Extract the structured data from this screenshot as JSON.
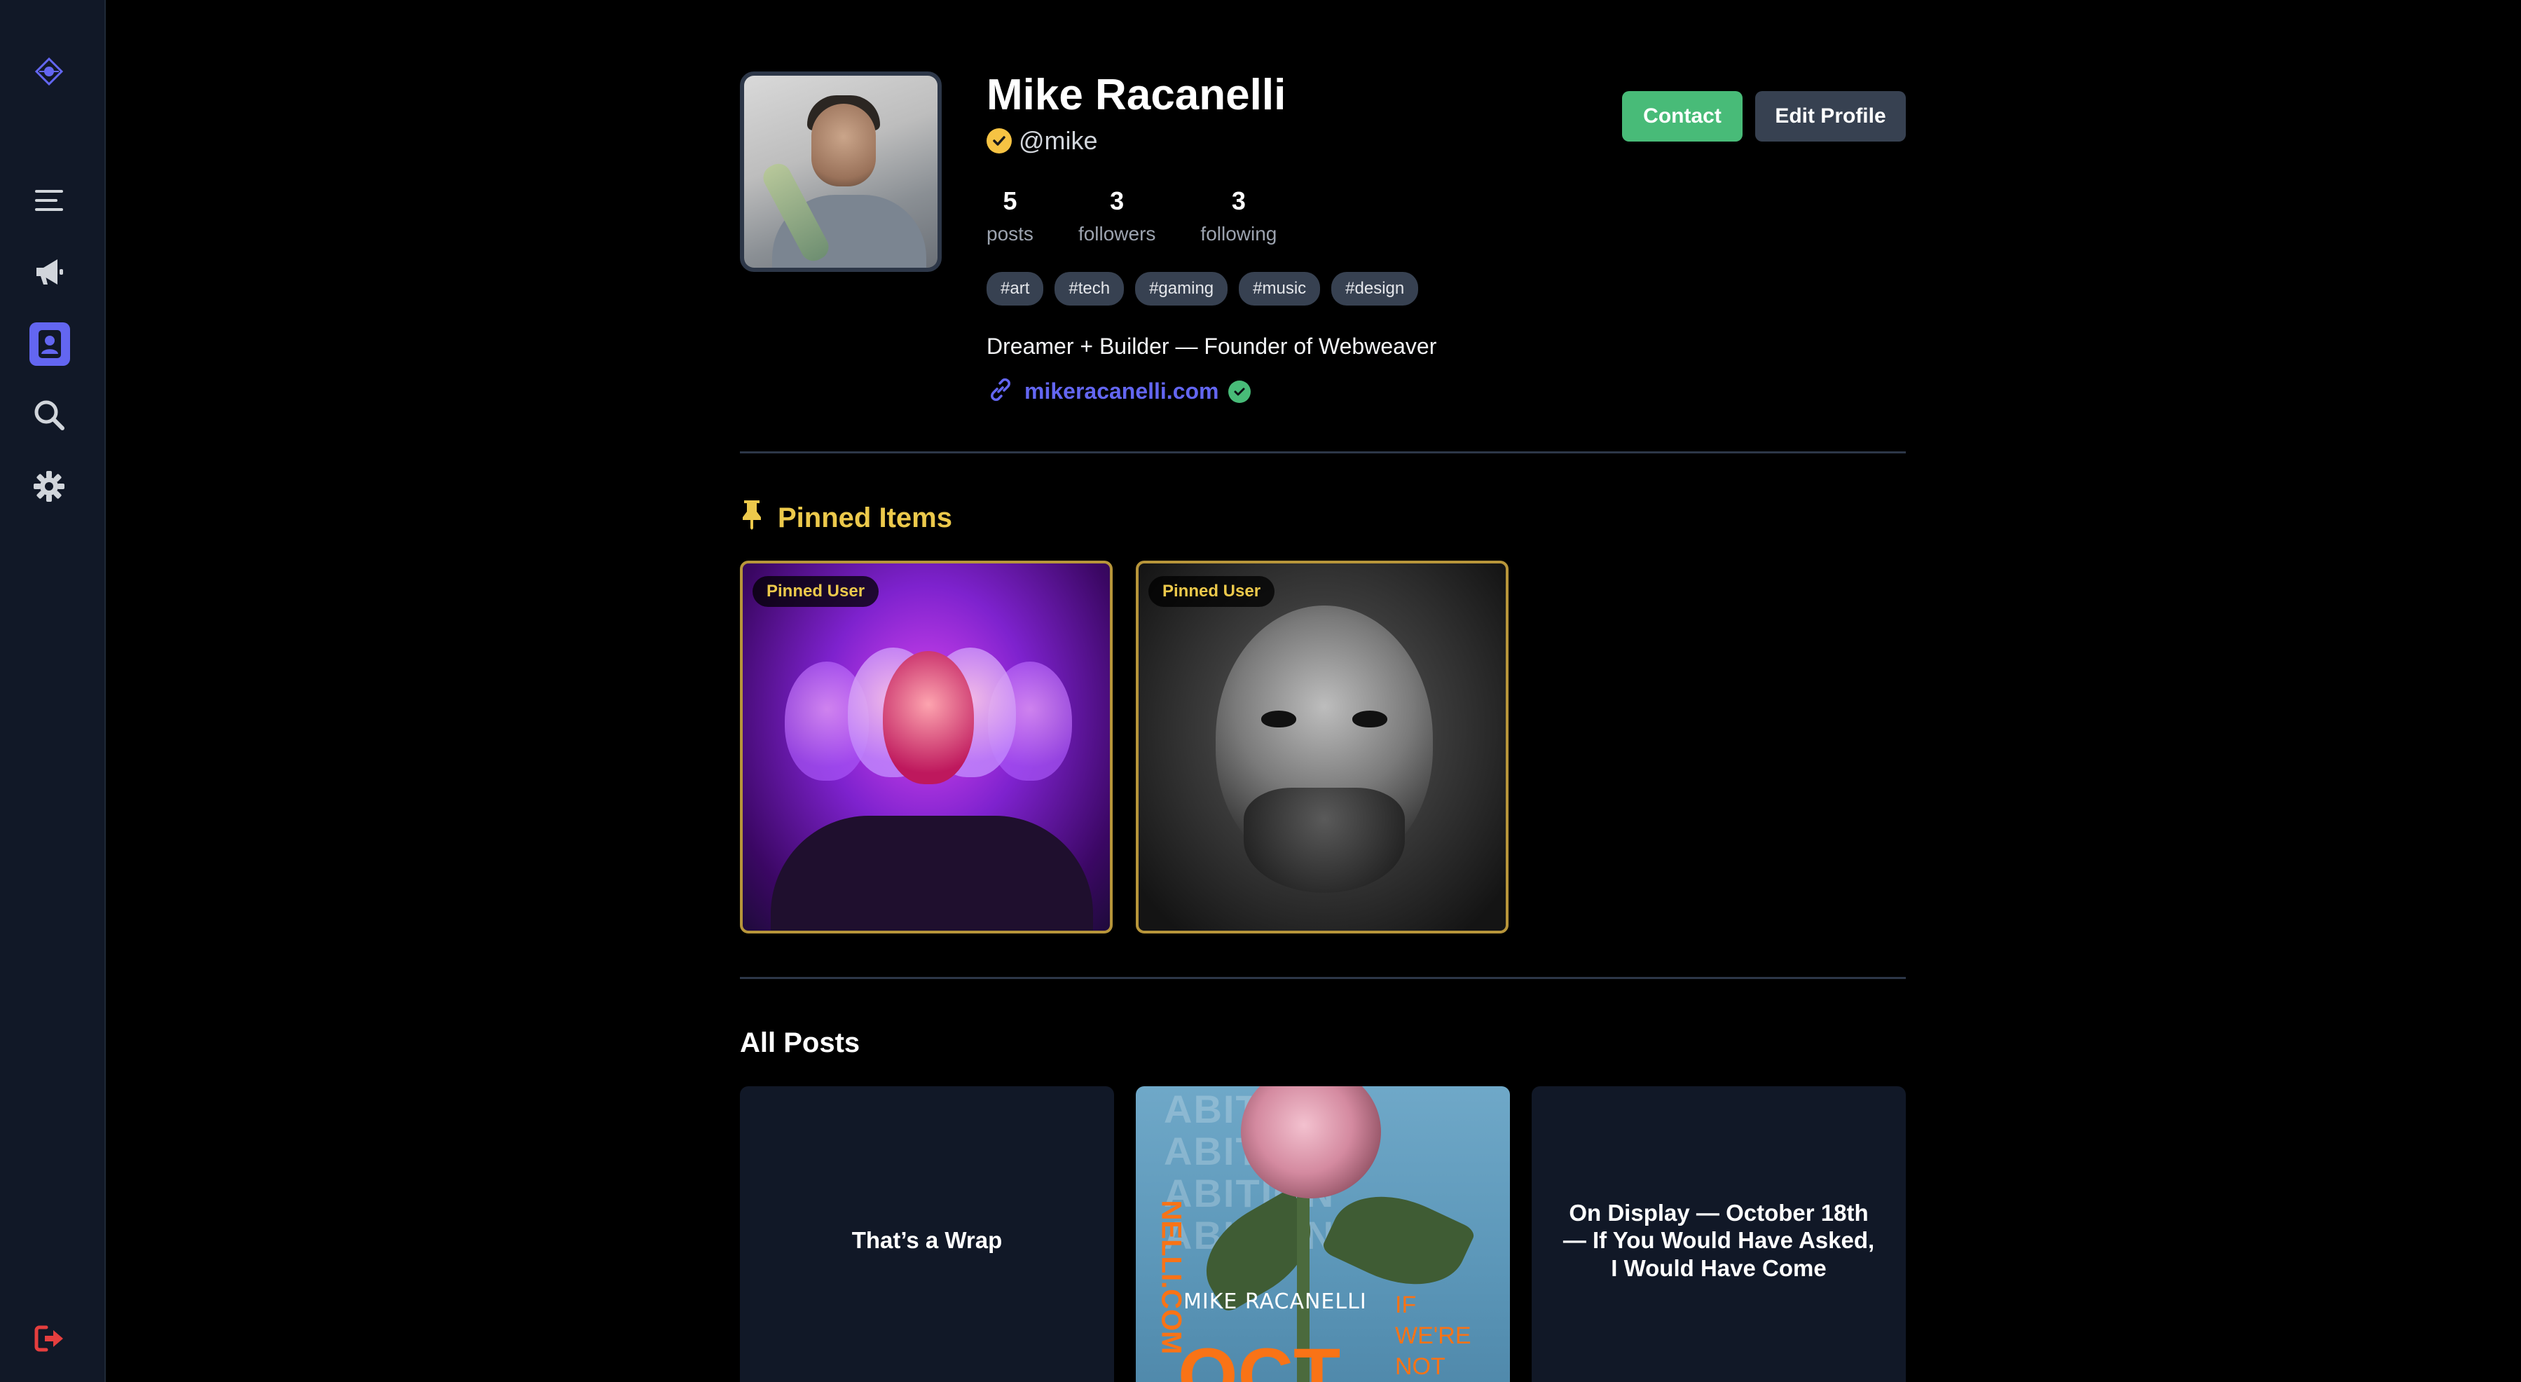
{
  "profile": {
    "name": "Mike Racanelli",
    "handle": "@mike",
    "bio": "Dreamer + Builder — Founder of Webweaver",
    "website": "mikeracanelli.com",
    "stats": [
      {
        "value": "5",
        "label": "posts"
      },
      {
        "value": "3",
        "label": "followers"
      },
      {
        "value": "3",
        "label": "following"
      }
    ],
    "tags": [
      "#art",
      "#tech",
      "#gaming",
      "#music",
      "#design"
    ]
  },
  "actions": {
    "contact_label": "Contact",
    "edit_label": "Edit Profile"
  },
  "pinned": {
    "title": "Pinned Items",
    "items": [
      {
        "badge": "Pinned User"
      },
      {
        "badge": "Pinned User"
      }
    ]
  },
  "posts": {
    "title": "All Posts",
    "items": [
      {
        "title": "That’s a Wrap"
      },
      {
        "poster_name": "MIKE RACANELLI",
        "poster_oct": "OCT",
        "poster_tag": "IF WE'RE NOT GHOSTS,",
        "poster_vertical": "NELLI.COM",
        "poster_bg_word": "ABITION"
      },
      {
        "title": "On Display — October 18th — If You Would Have Asked, I Would Have Come"
      }
    ]
  },
  "sidebar": {
    "icons": [
      "logo-icon",
      "menu-icon",
      "megaphone-icon",
      "profile-icon",
      "search-icon",
      "gear-icon",
      "logout-icon"
    ]
  },
  "colors": {
    "accent": "#6366f1",
    "contact": "#48bb78",
    "pinned_gold": "#ecc94b",
    "logout": "#e53e3e",
    "background": "#000000",
    "sidebar": "#111827"
  }
}
